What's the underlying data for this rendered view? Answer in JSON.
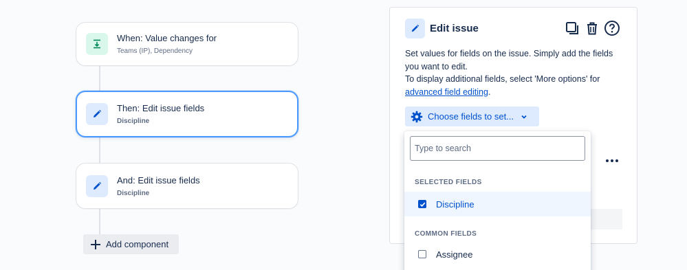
{
  "flow": {
    "trigger": {
      "title": "When: Value changes for",
      "subtitle": "Teams (IP), Dependency"
    },
    "action1": {
      "title": "Then: Edit issue fields",
      "subtitle": "Discipline"
    },
    "action2": {
      "title": "And: Edit issue fields",
      "subtitle": "Discipline"
    },
    "add_component_label": "Add component"
  },
  "panel": {
    "title": "Edit issue",
    "description_line1": "Set values for fields on the issue. Simply add the fields you want to edit.",
    "description_line2": "To display additional fields, select 'More options' for",
    "link_text": "advanced field editing",
    "link_suffix": ".",
    "choose_button_label": "Choose fields to set...",
    "icons": [
      "pencil-icon",
      "copy-icon",
      "trash-icon",
      "help-icon",
      "more-icon"
    ]
  },
  "dropdown": {
    "search_placeholder": "Type to search",
    "selected_heading": "SELECTED FIELDS",
    "selected_items": [
      {
        "label": "Discipline",
        "checked": true
      }
    ],
    "common_heading": "COMMON FIELDS",
    "common_items": [
      {
        "label": "Assignee",
        "checked": false
      }
    ]
  },
  "colors": {
    "accent": "#0052cc",
    "selected_border": "#4c9aff",
    "trigger_icon_bg": "#d9f7ea",
    "action_icon_bg": "#deebff"
  }
}
